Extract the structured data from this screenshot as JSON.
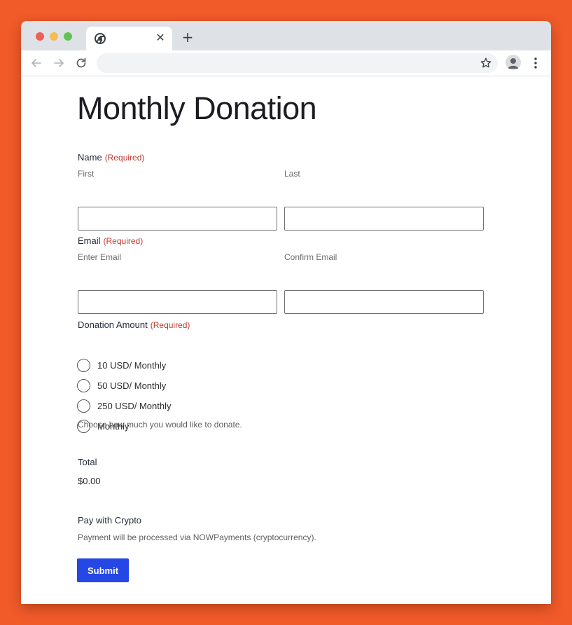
{
  "browser": {
    "tab": {
      "title": "",
      "favicon_icon": "chrome-icon",
      "close_icon": "close-icon"
    },
    "new_tab_icon": "plus-icon",
    "toolbar": {
      "back_icon": "arrow-left-icon",
      "forward_icon": "arrow-right-icon",
      "reload_icon": "reload-icon",
      "address": "",
      "bookmark_icon": "star-icon",
      "profile_icon": "avatar-icon",
      "menu_icon": "kebab-menu-icon"
    }
  },
  "form": {
    "title": "Monthly Donation",
    "required_text": "(Required)",
    "name": {
      "label": "Name",
      "first_label": "First",
      "first_value": "",
      "last_label": "Last",
      "last_value": ""
    },
    "email": {
      "label": "Email",
      "enter_label": "Enter Email",
      "enter_value": "",
      "confirm_label": "Confirm Email",
      "confirm_value": ""
    },
    "donation": {
      "label": "Donation Amount",
      "options": [
        {
          "label": "10 USD/ Monthly",
          "selected": false
        },
        {
          "label": "50 USD/ Monthly",
          "selected": false
        },
        {
          "label": "250 USD/ Monthly",
          "selected": false
        },
        {
          "label": "Monthly",
          "selected": false
        }
      ],
      "help": "Choose how much you would like to donate."
    },
    "total": {
      "label": "Total",
      "value": "$0.00"
    },
    "crypto": {
      "label": "Pay with Crypto",
      "note": "Payment will be processed via NOWPayments (cryptocurrency)."
    },
    "submit_label": "Submit"
  },
  "colors": {
    "background": "#f15a29",
    "required": "#c0392b",
    "submit_button": "#2447e6"
  }
}
